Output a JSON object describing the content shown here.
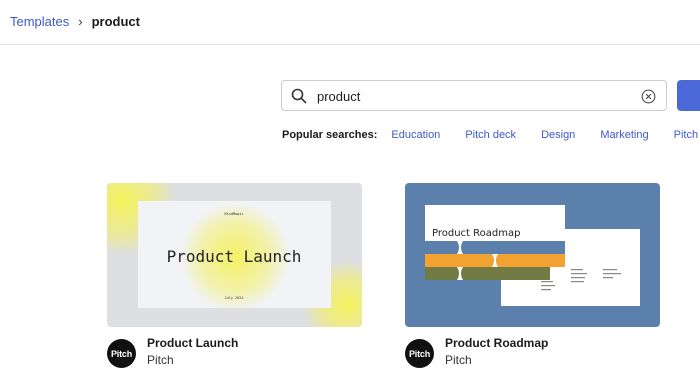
{
  "breadcrumb": {
    "root": "Templates",
    "separator": "›",
    "current": "product"
  },
  "search": {
    "value": "product",
    "button_color": "#4b68d8"
  },
  "popular": {
    "label": "Popular searches:",
    "items": [
      "Education",
      "Pitch deck",
      "Design",
      "Marketing",
      "Pitch decks"
    ]
  },
  "templates": [
    {
      "title": "Product Launch",
      "author": "Pitch",
      "avatar_text": "Pitch",
      "thumb": {
        "heading": "Product Launch",
        "brand": "MindMagic",
        "date": "July 2024"
      }
    },
    {
      "title": "Product Roadmap",
      "author": "Pitch",
      "avatar_text": "Pitch",
      "thumb": {
        "heading": "Product Roadmap"
      }
    }
  ],
  "colors": {
    "link": "#3f59c9",
    "accent": "#4b68d8",
    "roadmap_bg": "#5a80ab"
  }
}
